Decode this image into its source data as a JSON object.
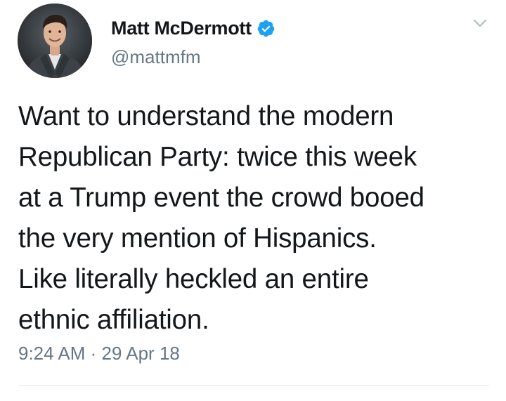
{
  "user": {
    "display_name": "Matt McDermott",
    "handle": "@mattmfm",
    "verified": true,
    "avatar_icon": "profile-photo"
  },
  "tweet": {
    "lines": [
      "Want to understand the modern",
      "Republican Party: twice this week",
      "at a Trump event the crowd booed",
      "the very mention of Hispanics.",
      "Like literally heckled an entire",
      "ethnic affiliation."
    ],
    "time": "9:24 AM",
    "separator": "·",
    "date": "29 Apr 18"
  },
  "icons": {
    "verified": "verified-badge-icon",
    "menu": "chevron-down-icon"
  },
  "colors": {
    "text": "#14171a",
    "secondary": "#657786",
    "verified_blue": "#1da1f2",
    "divider": "#e1e8ed"
  }
}
